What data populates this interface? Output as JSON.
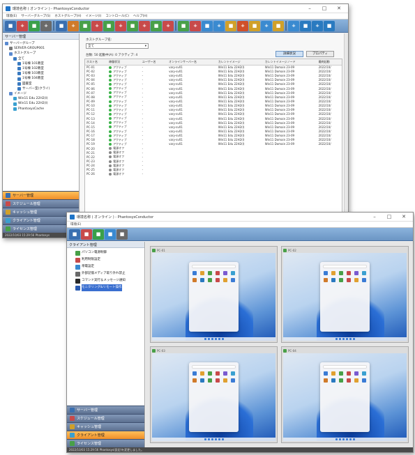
{
  "win1": {
    "title": "環境名称 ( オンライン ) - PhantosysConductor",
    "menu": [
      "環境(E)",
      "サーバーグループ(S)",
      "ホストグループ(H)",
      "イメージ(I)",
      "コントロール(C)",
      "ヘルプ(H)"
    ],
    "left_head": "サーバー管理",
    "tree": [
      "サーバーグループ",
      "SERVER-GROUP001",
      "ホストグループ",
      "全て",
      "1号棟 101教室",
      "1号棟 102教室",
      "1号棟 103教室",
      "1号棟 104教室",
      "図書室",
      "サーバー室(クライ)",
      "イメージ",
      "Win11 Edu 22H2(I)",
      "Win11 Edu 22H2(I)",
      "PhantosysCache"
    ],
    "nav": [
      {
        "label": "サーバー管理",
        "icon": "server-icon",
        "active": true
      },
      {
        "label": "スケジュール管理",
        "icon": "schedule-icon",
        "active": false
      },
      {
        "label": "キャッシュ管理",
        "icon": "cache-icon",
        "active": false
      },
      {
        "label": "クライアント管理",
        "icon": "client-icon",
        "active": false
      },
      {
        "label": "ライセンス管理",
        "icon": "license-icon",
        "active": false
      }
    ],
    "status": "2022/10/03 15:29:56 Phantosys",
    "group_label": "ホストグループ名:",
    "group_value": "全て",
    "counts": "台数: 50 起動中(A): 0 アクティブ: 4",
    "tab_info": "詳細状況",
    "tab_prop": "プロパティ",
    "columns": [
      "ホスト名",
      "稼働状況",
      "ユーザー名",
      "オンラインサーバー名",
      "カレントイメージ",
      "カレントイメージノード",
      "最終起動"
    ],
    "rows": [
      [
        "PC-01",
        "アクティブ",
        "-",
        "vary-sv01",
        "Win11 Edu 22H2(I)",
        "Win11 Domain 23-09",
        "2022/10/"
      ],
      [
        "PC-02",
        "アクティブ",
        "-",
        "vary-sv01",
        "Win11 Edu 22H2(I)",
        "Win11 Domain 23-09",
        "2022/10/"
      ],
      [
        "PC-03",
        "アクティブ",
        "-",
        "vary-sv01",
        "Win11 Edu 22H2(I)",
        "Win11 Domain 23-09",
        "2022/10/"
      ],
      [
        "PC-04",
        "アクティブ",
        "-",
        "vary-sv01",
        "Win11 Edu 22H2(I)",
        "Win11 Domain 23-09",
        "2022/10/"
      ],
      [
        "PC-05",
        "アクティブ",
        "-",
        "vary-sv01",
        "Win11 Edu 22H2(I)",
        "Win11 Domain 23-09",
        "2022/10/"
      ],
      [
        "PC-06",
        "アクティブ",
        "-",
        "vary-sv01",
        "Win11 Edu 22H2(I)",
        "Win11 Domain 23-09",
        "2022/10/"
      ],
      [
        "PC-07",
        "アクティブ",
        "-",
        "vary-sv01",
        "Win11 Edu 22H2(I)",
        "Win11 Domain 23-09",
        "2022/10/"
      ],
      [
        "PC-08",
        "アクティブ",
        "-",
        "vary-sv01",
        "Win11 Edu 22H2(I)",
        "Win11 Domain 23-09",
        "2022/10/"
      ],
      [
        "PC-09",
        "アクティブ",
        "-",
        "vary-sv01",
        "Win11 Edu 22H2(I)",
        "Win11 Domain 23-09",
        "2022/10/"
      ],
      [
        "PC-10",
        "アクティブ",
        "-",
        "vary-sv01",
        "Win11 Edu 22H2(I)",
        "Win11 Domain 23-09",
        "2022/10/"
      ],
      [
        "PC-11",
        "アクティブ",
        "-",
        "vary-sv01",
        "Win11 Edu 22H2(I)",
        "Win11 Domain 23-09",
        "2022/10/"
      ],
      [
        "PC-12",
        "アクティブ",
        "-",
        "vary-sv01",
        "Win11 Edu 22H2(I)",
        "Win11 Domain 23-09",
        "2022/10/"
      ],
      [
        "PC-13",
        "アクティブ",
        "-",
        "vary-sv01",
        "Win11 Edu 22H2(I)",
        "Win11 Domain 23-09",
        "2022/10/"
      ],
      [
        "PC-14",
        "アクティブ",
        "-",
        "vary-sv01",
        "Win11 Edu 22H2(I)",
        "Win11 Domain 23-09",
        "2022/10/"
      ],
      [
        "PC-15",
        "アクティブ",
        "-",
        "vary-sv01",
        "Win11 Edu 22H2(I)",
        "Win11 Domain 23-09",
        "2022/10/"
      ],
      [
        "PC-16",
        "アクティブ",
        "-",
        "vary-sv01",
        "Win11 Edu 22H2(I)",
        "Win11 Domain 23-09",
        "2022/10/"
      ],
      [
        "PC-17",
        "アクティブ",
        "-",
        "vary-sv01",
        "Win11 Edu 22H2(I)",
        "Win11 Domain 23-09",
        "2022/10/"
      ],
      [
        "PC-18",
        "アクティブ",
        "-",
        "vary-sv01",
        "Win11 Edu 22H2(I)",
        "Win11 Domain 23-09",
        "2022/10/"
      ],
      [
        "PC-19",
        "アクティブ",
        "-",
        "vary-sv01",
        "Win11 Edu 22H2(I)",
        "Win11 Domain 23-09",
        "2022/10/"
      ],
      [
        "PC-20",
        "電源オフ",
        "-",
        "",
        "",
        "",
        ""
      ],
      [
        "PC-21",
        "電源オフ",
        "-",
        "",
        "",
        "",
        ""
      ],
      [
        "PC-22",
        "電源オフ",
        "-",
        "",
        "",
        "",
        ""
      ],
      [
        "PC-23",
        "電源オフ",
        "-",
        "",
        "",
        "",
        ""
      ],
      [
        "PC-24",
        "電源オフ",
        "-",
        "",
        "",
        "",
        ""
      ],
      [
        "PC-25",
        "電源オフ",
        "-",
        "",
        "",
        "",
        ""
      ],
      [
        "PC-26",
        "電源オフ",
        "-",
        "",
        "",
        "",
        ""
      ]
    ]
  },
  "win2": {
    "title": "環境名称 ( オンライン ) - PhantosysConductor",
    "menu": [
      "環境(E)"
    ],
    "left_head": "クライアント管理",
    "tree": [
      "パソコン電源制御",
      "利用制限設定",
      "帯電設定",
      "外部記憶メディア取り外れ禁止",
      "コマンド実行＆メッセージ通知",
      "モニタリング&リモート操作"
    ],
    "nav": [
      {
        "label": "サーバー管理",
        "icon": "server-icon",
        "active": false
      },
      {
        "label": "スケジュール管理",
        "icon": "schedule-icon",
        "active": false
      },
      {
        "label": "キャッシュ管理",
        "icon": "cache-icon",
        "active": false
      },
      {
        "label": "クライアント管理",
        "icon": "client-icon",
        "active": true
      },
      {
        "label": "ライセンス管理",
        "icon": "license-icon",
        "active": false
      }
    ],
    "status": "2022/10/03 15:29:56 Phantosys(設定)を変更しました。",
    "thumbs": [
      "PC-01",
      "PC-02",
      "PC-03",
      "PC-04"
    ]
  }
}
